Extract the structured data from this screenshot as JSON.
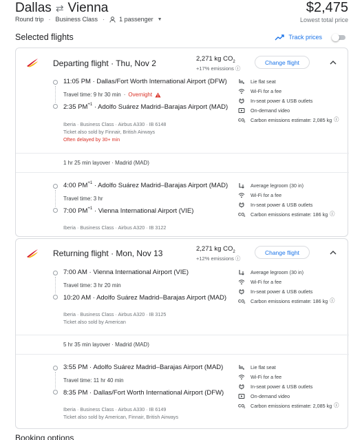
{
  "header": {
    "origin": "Dallas",
    "destination": "Vienna",
    "trip_type": "Round trip",
    "cabin": "Business Class",
    "passengers": "1 passenger",
    "price": "$2,475",
    "price_note": "Lowest total price"
  },
  "selected": {
    "title": "Selected flights",
    "track_label": "Track prices",
    "info_glyph": "ⓘ"
  },
  "departing": {
    "title": "Departing flight",
    "date": "Thu, Nov 2",
    "co2": "2,271 kg CO",
    "co2_sub": "2",
    "co2_delta": "+17% emissions",
    "change_label": "Change flight",
    "leg1": {
      "dep_time": "11:05 PM",
      "dep_airport": "Dallas/Fort Worth International Airport (DFW)",
      "travel_time": "Travel time: 9 hr 30 min",
      "overnight": "Overnight",
      "arr_time": "2:35 PM",
      "arr_plus": "+1",
      "arr_airport": "Adolfo Suárez Madrid–Barajas Airport (MAD)",
      "details": "Iberia · Business Class · Airbus A330 · IB 6148",
      "sold_by": "Ticket also sold by Finnair, British Airways",
      "delay": "Often delayed by 30+ min",
      "amenities": [
        {
          "icon": "seat-icon",
          "label": "Lie flat seat"
        },
        {
          "icon": "wifi-icon",
          "label": "Wi-Fi for a fee"
        },
        {
          "icon": "power-icon",
          "label": "In-seat power & USB outlets"
        },
        {
          "icon": "video-icon",
          "label": "On-demand video"
        },
        {
          "icon": "co2-icon",
          "label": "Carbon emissions estimate: 2,085 kg"
        }
      ]
    },
    "layover": "1 hr 25 min layover · Madrid (MAD)",
    "leg2": {
      "dep_time": "4:00 PM",
      "dep_plus": "+1",
      "dep_airport": "Adolfo Suárez Madrid–Barajas Airport (MAD)",
      "travel_time": "Travel time: 3 hr",
      "arr_time": "7:00 PM",
      "arr_plus": "+1",
      "arr_airport": "Vienna International Airport (VIE)",
      "details": "Iberia · Business Class · Airbus A320 · IB 3122",
      "amenities": [
        {
          "icon": "legroom-icon",
          "label": "Average legroom (30 in)"
        },
        {
          "icon": "wifi-icon",
          "label": "Wi-Fi for a fee"
        },
        {
          "icon": "power-icon",
          "label": "In-seat power & USB outlets"
        },
        {
          "icon": "co2-icon",
          "label": "Carbon emissions estimate: 186 kg"
        }
      ]
    }
  },
  "returning": {
    "title": "Returning flight",
    "date": "Mon, Nov 13",
    "co2": "2,271 kg CO",
    "co2_sub": "2",
    "co2_delta": "+12% emissions",
    "change_label": "Change flight",
    "leg1": {
      "dep_time": "7:00 AM",
      "dep_airport": "Vienna International Airport (VIE)",
      "travel_time": "Travel time: 3 hr 20 min",
      "arr_time": "10:20 AM",
      "arr_airport": "Adolfo Suárez Madrid–Barajas Airport (MAD)",
      "details": "Iberia · Business Class · Airbus A320 · IB 3125",
      "sold_by": "Ticket also sold by American",
      "amenities": [
        {
          "icon": "legroom-icon",
          "label": "Average legroom (30 in)"
        },
        {
          "icon": "wifi-icon",
          "label": "Wi-Fi for a fee"
        },
        {
          "icon": "power-icon",
          "label": "In-seat power & USB outlets"
        },
        {
          "icon": "co2-icon",
          "label": "Carbon emissions estimate: 186 kg"
        }
      ]
    },
    "layover": "5 hr 35 min layover · Madrid (MAD)",
    "leg2": {
      "dep_time": "3:55 PM",
      "dep_airport": "Adolfo Suárez Madrid–Barajas Airport (MAD)",
      "travel_time": "Travel time: 11 hr 40 min",
      "arr_time": "8:35 PM",
      "arr_airport": "Dallas/Fort Worth International Airport (DFW)",
      "details": "Iberia · Business Class · Airbus A330 · IB 6149",
      "sold_by": "Ticket also sold by American, Finnair, British Airways",
      "amenities": [
        {
          "icon": "seat-icon",
          "label": "Lie flat seat"
        },
        {
          "icon": "wifi-icon",
          "label": "Wi-Fi for a fee"
        },
        {
          "icon": "power-icon",
          "label": "In-seat power & USB outlets"
        },
        {
          "icon": "video-icon",
          "label": "On-demand video"
        },
        {
          "icon": "co2-icon",
          "label": "Carbon emissions estimate: 2,085 kg"
        }
      ]
    }
  },
  "colors": {
    "accent": "#1a73e8",
    "warning": "#d93025",
    "iberia_red": "#d7192d",
    "iberia_yellow": "#f8b219"
  },
  "footer_partial": "Booking options"
}
